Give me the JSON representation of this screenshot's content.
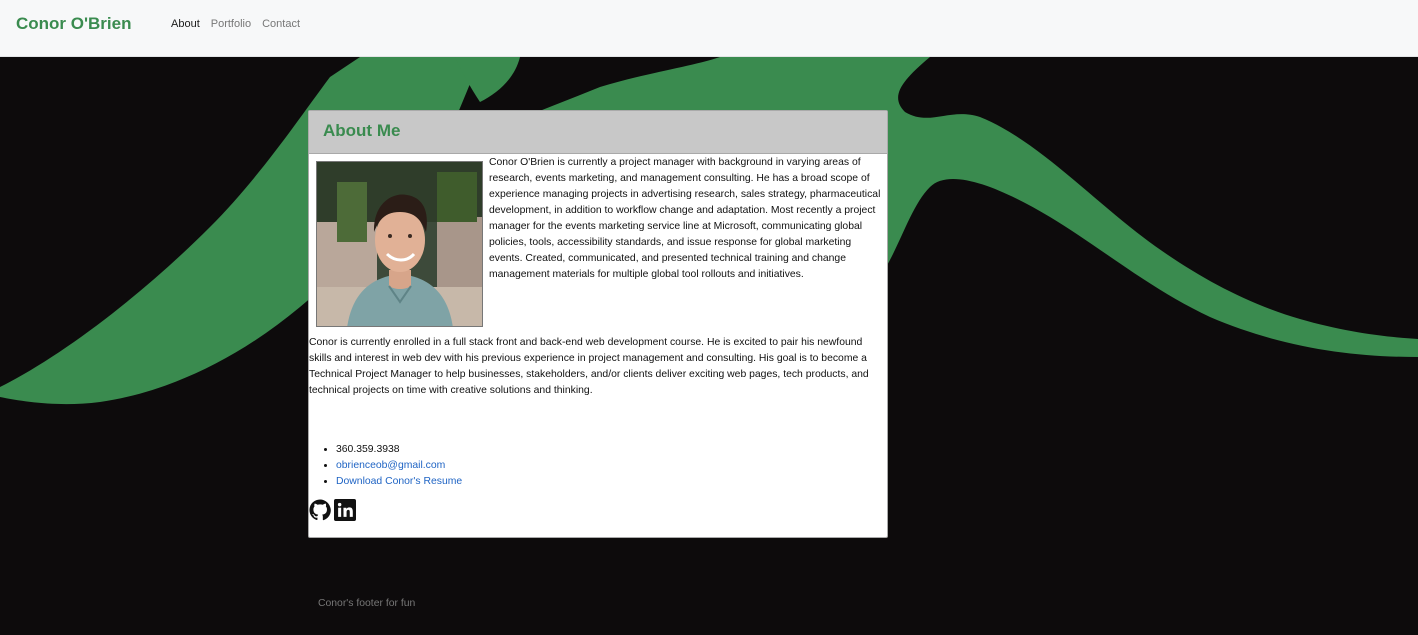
{
  "navbar": {
    "brand": "Conor O'Brien",
    "links": [
      {
        "label": "About",
        "active": true
      },
      {
        "label": "Portfolio",
        "active": false
      },
      {
        "label": "Contact",
        "active": false
      }
    ]
  },
  "about": {
    "title": "About Me",
    "bio_paragraph_1": "Conor O'Brien is currently a project manager with background in varying areas of research, events marketing, and management consulting. He has a broad scope of experience managing projects in advertising research, sales strategy, pharmaceutical development, in addition to workflow change and adaptation. Most recently a project manager for the events marketing service line at Microsoft, communicating global policies, tools, accessibility standards, and issue response for global marketing events. Created, communicated, and presented technical training and change management materials for multiple global tool rollouts and initiatives.",
    "bio_paragraph_2": "Conor is currently enrolled in a full stack front and back-end web development course. He is excited to pair his newfound skills and interest in web dev with his previous experience in project management and consulting. His goal is to become a Technical Project Manager to help businesses, stakeholders, and/or clients deliver exciting web pages, tech products, and technical projects on time with creative solutions and thinking.",
    "contacts": {
      "phone": "360.359.3938",
      "email": "obrienceob@gmail.com",
      "resume": "Download Conor's Resume"
    },
    "social_icons": [
      "github-icon",
      "linkedin-icon"
    ]
  },
  "footer": {
    "text": "Conor's footer for fun"
  },
  "colors": {
    "brand_green": "#3a8b4f",
    "background": "#0d0b0c",
    "link_blue": "#1f64c4"
  }
}
